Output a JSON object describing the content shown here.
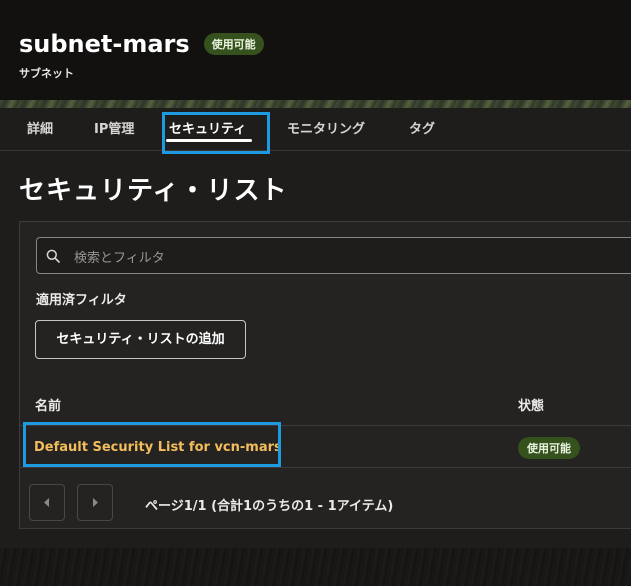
{
  "header": {
    "title": "subnet-mars",
    "status_badge": "使用可能",
    "subtitle": "サブネット"
  },
  "tabs": [
    {
      "label": "詳細"
    },
    {
      "label": "IP管理"
    },
    {
      "label": "セキュリティ",
      "active": true
    },
    {
      "label": "モニタリング"
    },
    {
      "label": "タグ"
    }
  ],
  "section": {
    "title": "セキュリティ・リスト"
  },
  "search": {
    "placeholder": "検索とフィルタ",
    "icon": "search-icon"
  },
  "filters": {
    "label": "適用済フィルタ"
  },
  "actions": {
    "add_label": "セキュリティ・リストの追加"
  },
  "table": {
    "columns": [
      "名前",
      "状態"
    ],
    "rows": [
      {
        "name": "Default Security List for vcn-mars",
        "status": "使用可能"
      }
    ]
  },
  "pagination": {
    "text": "ページ1/1 (合計1のうちの1 - 1アイテム)",
    "prev_icon": "chevron-left-icon",
    "next_icon": "chevron-right-icon"
  },
  "colors": {
    "background": "#1f1d1c",
    "header_bg": "#121110",
    "accent_link": "#f2bd5c",
    "status_green": "#35511e",
    "highlight": "#1e9be0"
  }
}
